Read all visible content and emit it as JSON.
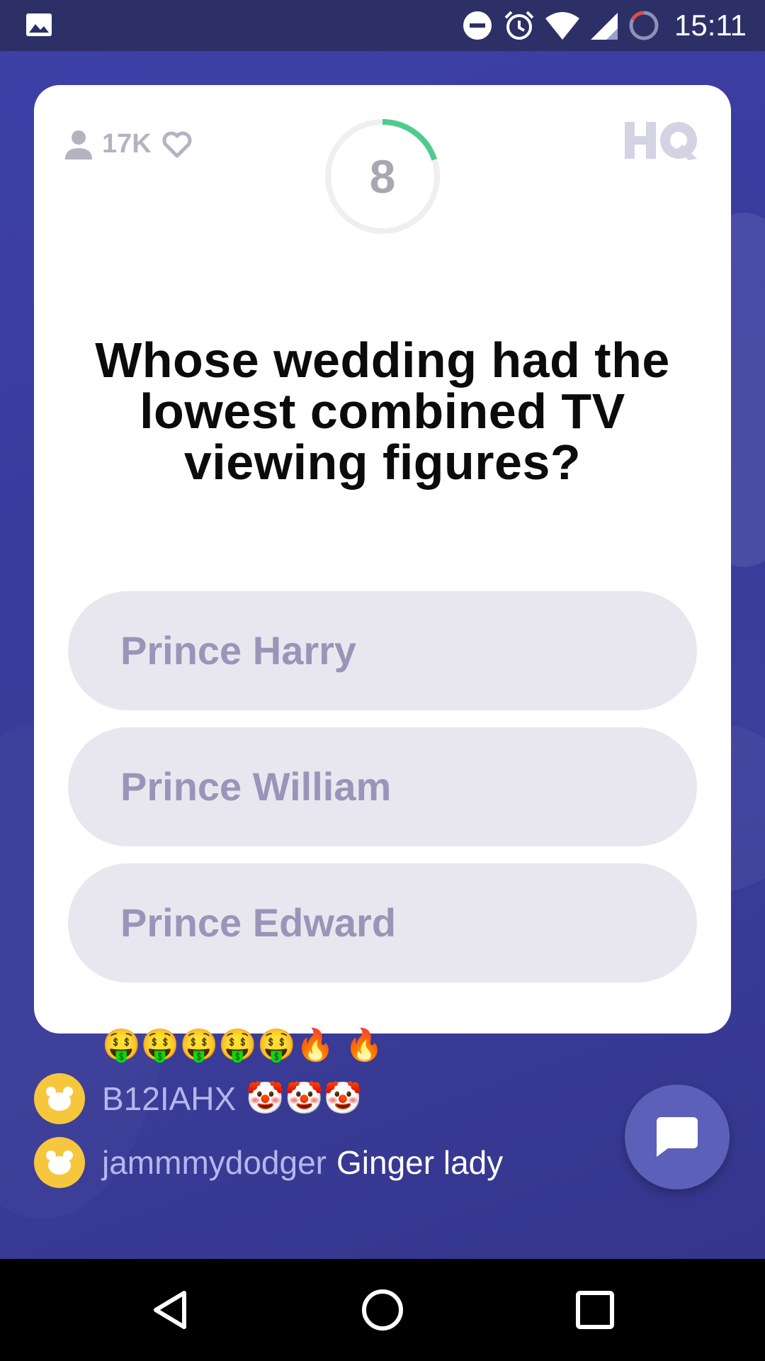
{
  "status_bar": {
    "time": "15:11",
    "icons": [
      "gallery-icon",
      "do-not-disturb-icon",
      "alarm-icon",
      "wifi-icon",
      "signal-icon",
      "battery-icon"
    ]
  },
  "card": {
    "viewer_count": "17K",
    "timer_value": "8",
    "timer_progress": 0.2,
    "logo": "HQ",
    "question": "Whose wedding had the lowest combined TV viewing figures?",
    "answers": [
      {
        "label": "Prince Harry"
      },
      {
        "label": "Prince William"
      },
      {
        "label": "Prince Edward"
      }
    ]
  },
  "chat": {
    "partial_message": "🤑🤑🤑🤑🤑🔥 🔥",
    "messages": [
      {
        "user": "B12IAHX",
        "text": "🤡🤡🤡"
      },
      {
        "user": "jammmydodger",
        "text": "Ginger lady"
      }
    ]
  },
  "colors": {
    "background": "#3a3c9e",
    "card": "#ffffff",
    "answer_bg": "#e8e7ef",
    "answer_text": "#9a95b8",
    "timer_progress": "#4ecb8e",
    "avatar": "#f6c73c",
    "chat_button": "#5c60b8"
  }
}
